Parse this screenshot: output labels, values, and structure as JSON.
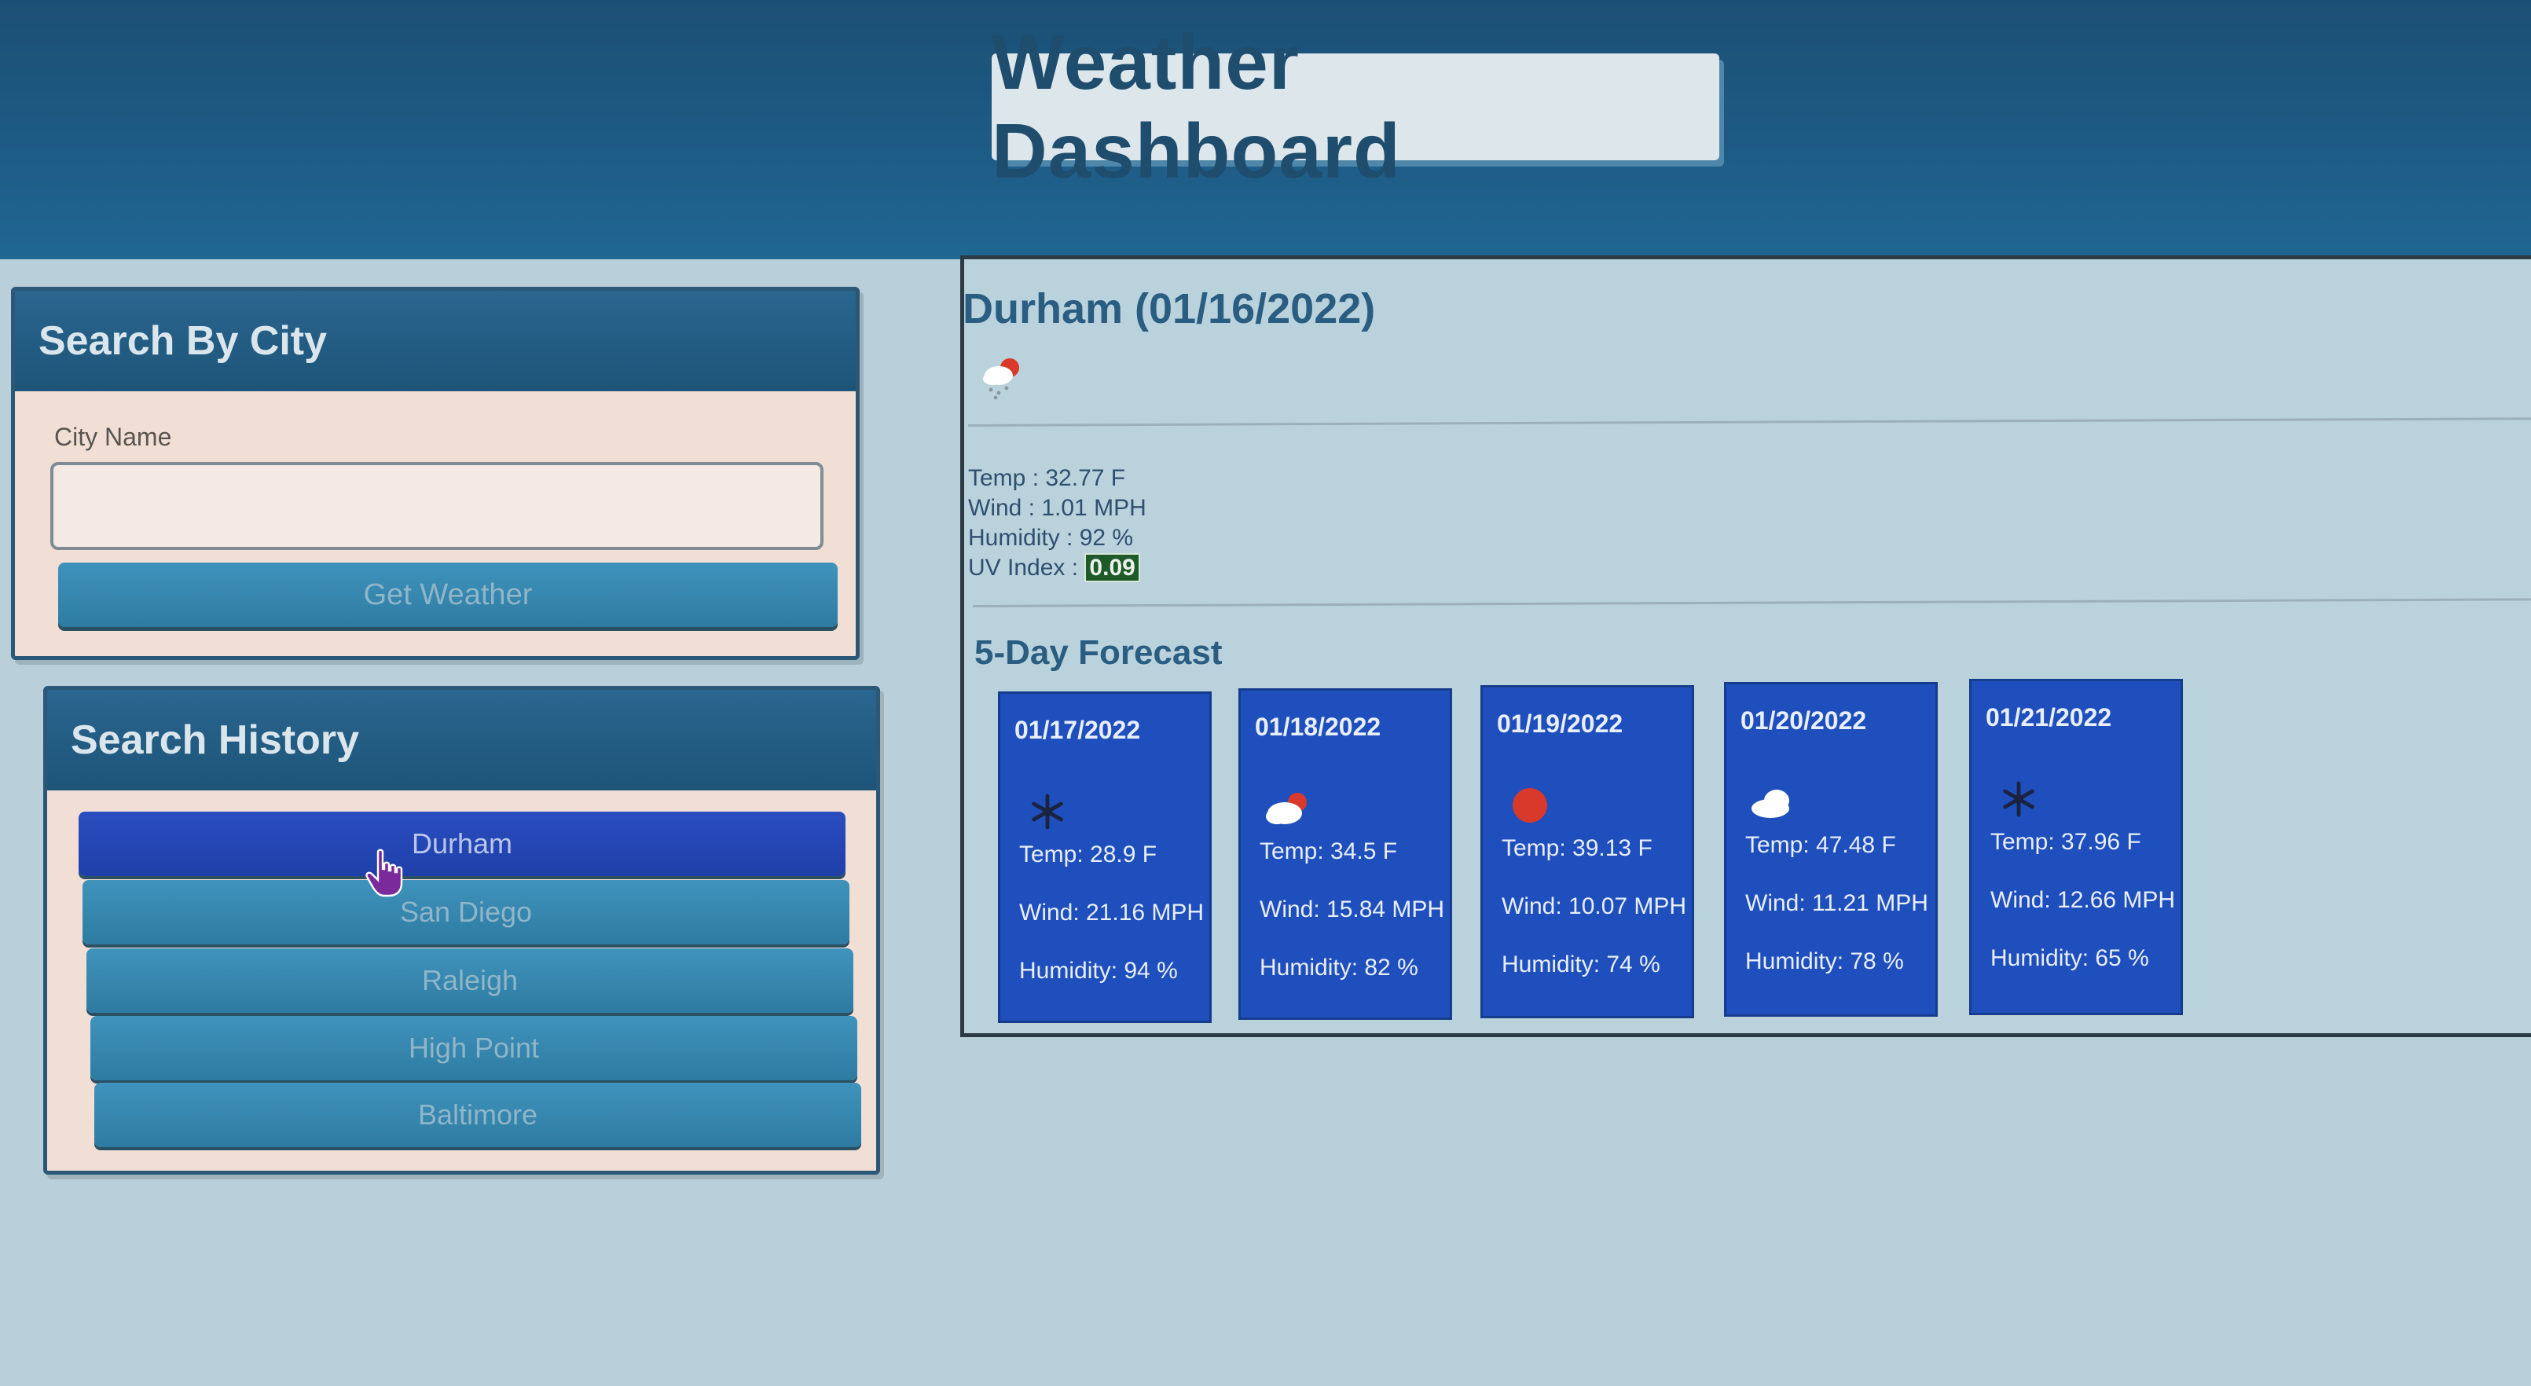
{
  "header": {
    "title": "Weather Dashboard"
  },
  "search": {
    "heading": "Search By City",
    "label": "City Name",
    "input_value": "",
    "button_label": "Get Weather"
  },
  "history": {
    "heading": "Search History",
    "items": [
      {
        "label": "Durham",
        "active": true
      },
      {
        "label": "San Diego",
        "active": false
      },
      {
        "label": "Raleigh",
        "active": false
      },
      {
        "label": "High Point",
        "active": false
      },
      {
        "label": "Baltimore",
        "active": false
      }
    ]
  },
  "current": {
    "title": "Durham (01/16/2022)",
    "icon": "snow-cloud-sun-icon",
    "temp": "Temp : 32.77 F",
    "wind": "Wind : 1.01 MPH",
    "humidity": "Humidity : 92 %",
    "uv_label": "UV Index :",
    "uv_value": "0.09"
  },
  "forecast": {
    "title": "5-Day Forecast",
    "days": [
      {
        "date": "01/17/2022",
        "icon": "snowflake-icon",
        "temp": "Temp: 28.9 F",
        "wind": "Wind: 21.16 MPH",
        "humidity": "Humidity: 94 %"
      },
      {
        "date": "01/18/2022",
        "icon": "cloud-sun-icon",
        "temp": "Temp: 34.5 F",
        "wind": "Wind: 15.84 MPH",
        "humidity": "Humidity: 82 %"
      },
      {
        "date": "01/19/2022",
        "icon": "sun-icon",
        "temp": "Temp: 39.13 F",
        "wind": "Wind: 10.07 MPH",
        "humidity": "Humidity: 74 %"
      },
      {
        "date": "01/20/2022",
        "icon": "cloud-icon",
        "temp": "Temp: 47.48 F",
        "wind": "Wind: 11.21 MPH",
        "humidity": "Humidity: 78 %"
      },
      {
        "date": "01/21/2022",
        "icon": "snowflake-icon",
        "temp": "Temp: 37.96 F",
        "wind": "Wind: 12.66 MPH",
        "humidity": "Humidity: 65 %"
      }
    ]
  },
  "colors": {
    "header_bg": "#1d5c86",
    "card_bg": "#1f4fbc",
    "button_bg": "#3487b1",
    "active_button_bg": "#2547b5",
    "uv_badge_bg": "#1e5a2a"
  }
}
